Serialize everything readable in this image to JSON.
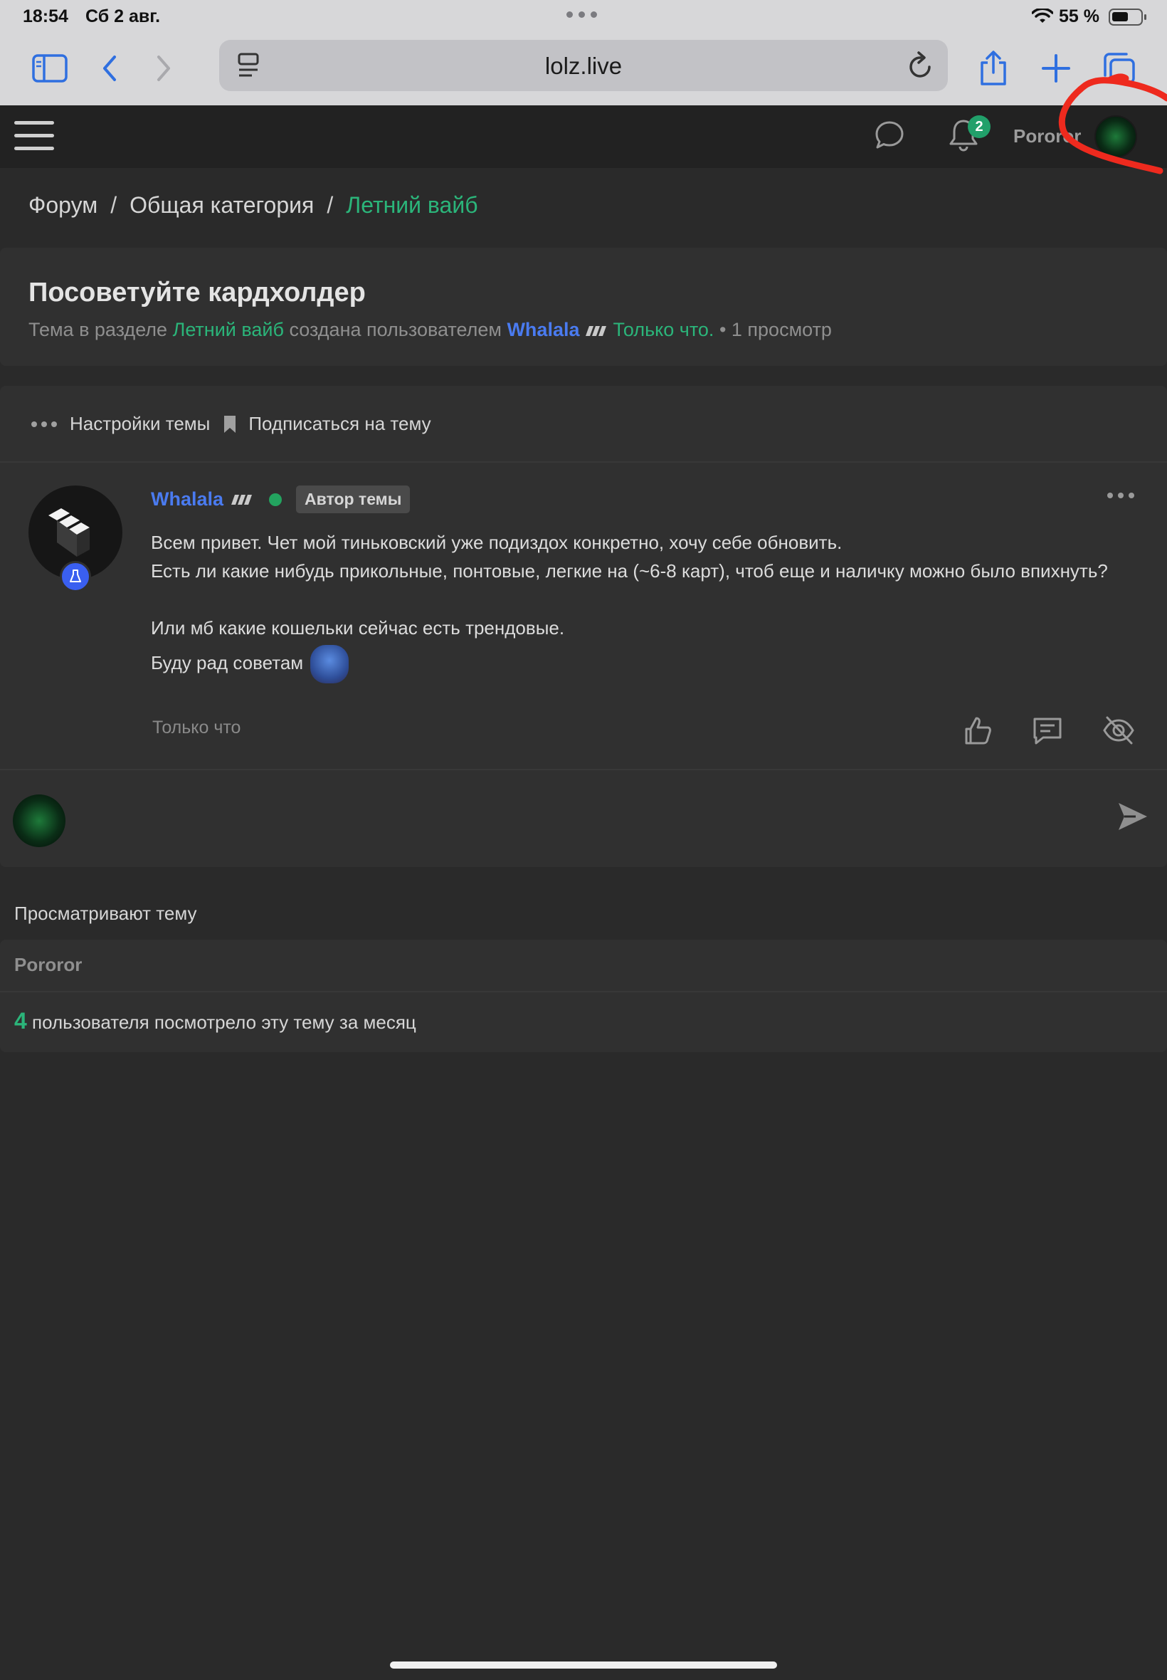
{
  "status_bar": {
    "time": "18:54",
    "date": "Сб 2 авг.",
    "battery_pct": "55 %",
    "battery_level": 0.55
  },
  "browser": {
    "url": "lolz.live",
    "icons": [
      "sidebar-icon",
      "back-icon",
      "forward-icon",
      "reader-icon",
      "reload-icon",
      "share-icon",
      "new-tab-icon",
      "tabs-icon"
    ]
  },
  "header": {
    "notification_count": "2",
    "username": "Pororor"
  },
  "breadcrumb": {
    "items": [
      "Форум",
      "Общая категория",
      "Летний вайб"
    ],
    "separator": "/"
  },
  "topic": {
    "title": "Посоветуйте кардхолдер",
    "meta_prefix": "Тема в разделе",
    "section": "Летний вайб",
    "meta_mid": "создана пользователем",
    "author": "Whalala",
    "created": "Только что.",
    "views": "• 1 просмотр"
  },
  "thread_actions": {
    "settings_label": "Настройки темы",
    "subscribe_label": "Подписаться на тему"
  },
  "post": {
    "author": "Whalala",
    "badge": "Автор темы",
    "lines": [
      "Всем привет. Чет мой тиньковский уже подиздох конкретно, хочу себе обновить.",
      "Есть ли какие нибудь прикольные, понтовые, легкие на (~6-8 карт), чтоб еще и наличку можно было впихнуть?",
      "",
      "Или мб какие кошельки сейчас есть трендовые.",
      "Буду рад советам"
    ],
    "time": "Только что"
  },
  "viewers": {
    "title": "Просматривают тему",
    "names": [
      "Pororor"
    ],
    "count": "4",
    "count_text": "пользователя посмотрело эту тему за месяц"
  },
  "colors": {
    "accent_green": "#2bb57a",
    "link_blue": "#4a7bf0",
    "background": "#2a2a2a",
    "panel": "#303030"
  }
}
